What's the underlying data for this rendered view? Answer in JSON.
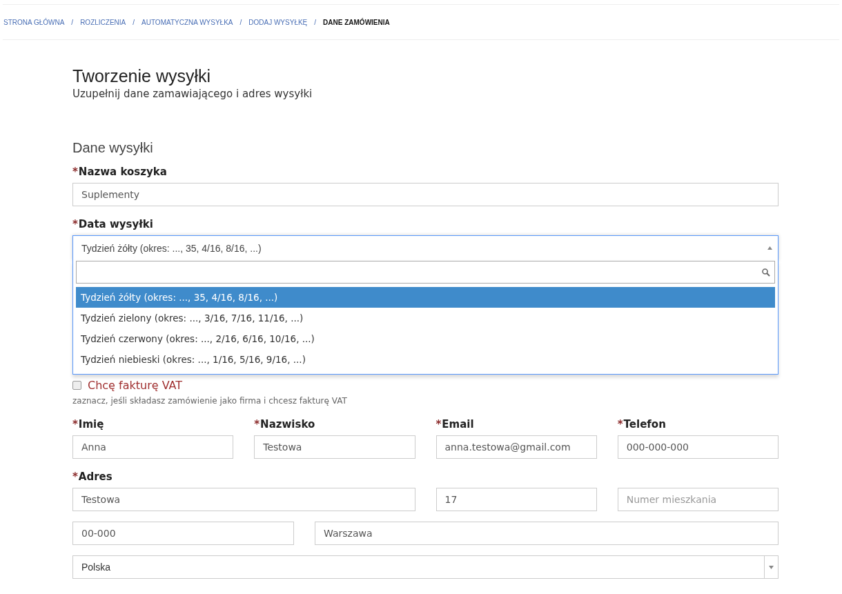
{
  "breadcrumb": [
    {
      "label": "STRONA GŁÓWNA",
      "current": false
    },
    {
      "label": "ROZLICZENIA",
      "current": false
    },
    {
      "label": "AUTOMATYCZNA WYSYŁKA",
      "current": false
    },
    {
      "label": "DODAJ WYSYŁKĘ",
      "current": false
    },
    {
      "label": "DANE ZAMÓWIENIA",
      "current": true
    }
  ],
  "breadcrumb_separator": "/",
  "page": {
    "title": "Tworzenie wysyłki",
    "subtitle": "Uzupełnij dane zamawiającego i adres wysyłki"
  },
  "section_title": "Dane wysyłki",
  "required_mark": "*",
  "basket": {
    "label": "Nazwa koszyka",
    "value": "Suplementy"
  },
  "ship_date": {
    "label": "Data wysyłki",
    "value": "Tydzień żółty (okres: ..., 35, 4/16, 8/16, ...)",
    "expanded": true,
    "options": [
      {
        "label": "Tydzień żółty (okres: ..., 35, 4/16, 8/16, ...)",
        "selected": true
      },
      {
        "label": "Tydzień zielony (okres: ..., 3/16, 7/16, 11/16, ...)",
        "selected": false
      },
      {
        "label": "Tydzień czerwony (okres: ..., 2/16, 6/16, 10/16, ...)",
        "selected": false
      },
      {
        "label": "Tydzień niebieski (okres: ..., 1/16, 5/16, 9/16, ...)",
        "selected": false
      }
    ]
  },
  "invoice": {
    "label": "Chcę fakturę VAT",
    "checked": false,
    "hint": "zaznacz, jeśli składasz zamówienie jako firma i chcesz fakturę VAT"
  },
  "contact": [
    {
      "label": "Imię",
      "value": "Anna"
    },
    {
      "label": "Nazwisko",
      "value": "Testowa"
    },
    {
      "label": "Email",
      "value": "anna.testowa@gmail.com"
    },
    {
      "label": "Telefon",
      "value": "000-000-000"
    }
  ],
  "address": {
    "label": "Adres",
    "street": {
      "value": "Testowa"
    },
    "number": {
      "value": "17"
    },
    "apartment": {
      "placeholder": "Numer mieszkania"
    },
    "postal_code": {
      "value": "00-000"
    },
    "city": {
      "value": "Warszawa"
    },
    "country": {
      "value": "Polska"
    }
  }
}
